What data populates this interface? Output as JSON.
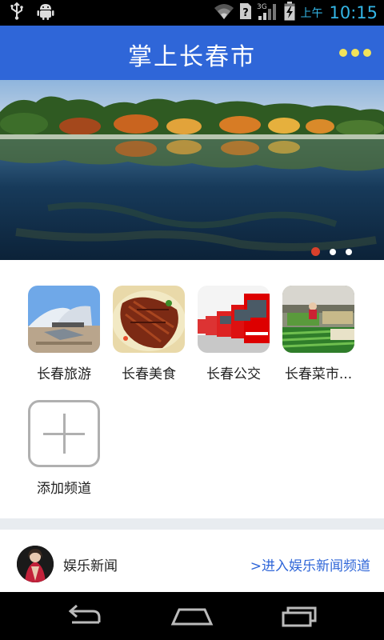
{
  "status_bar": {
    "ampm": "上午",
    "time": "10:15",
    "network": "3G",
    "icons": [
      "usb-icon",
      "android-debug-icon",
      "wifi-icon",
      "signal-icon",
      "battery-charging-icon"
    ]
  },
  "header": {
    "title": "掌上长春市",
    "menu_icon": "more-dots-icon"
  },
  "banner": {
    "slide_count": 3,
    "active_index": 0
  },
  "channels": {
    "items": [
      {
        "label": "长春旅游"
      },
      {
        "label": "长春美食"
      },
      {
        "label": "长春公交"
      },
      {
        "label": "长春菜市..."
      }
    ],
    "add_label": "添加频道"
  },
  "news": {
    "title": "娱乐新闻",
    "link": ">进入娱乐新闻频道"
  },
  "nav": {
    "icons": [
      "back-icon",
      "home-icon",
      "recent-apps-icon"
    ]
  },
  "colors": {
    "header": "#2f66d8",
    "accent_time": "#33b5e5",
    "link": "#2f66d8",
    "dots": "#f2e35a",
    "pager_active": "#d9402b"
  }
}
